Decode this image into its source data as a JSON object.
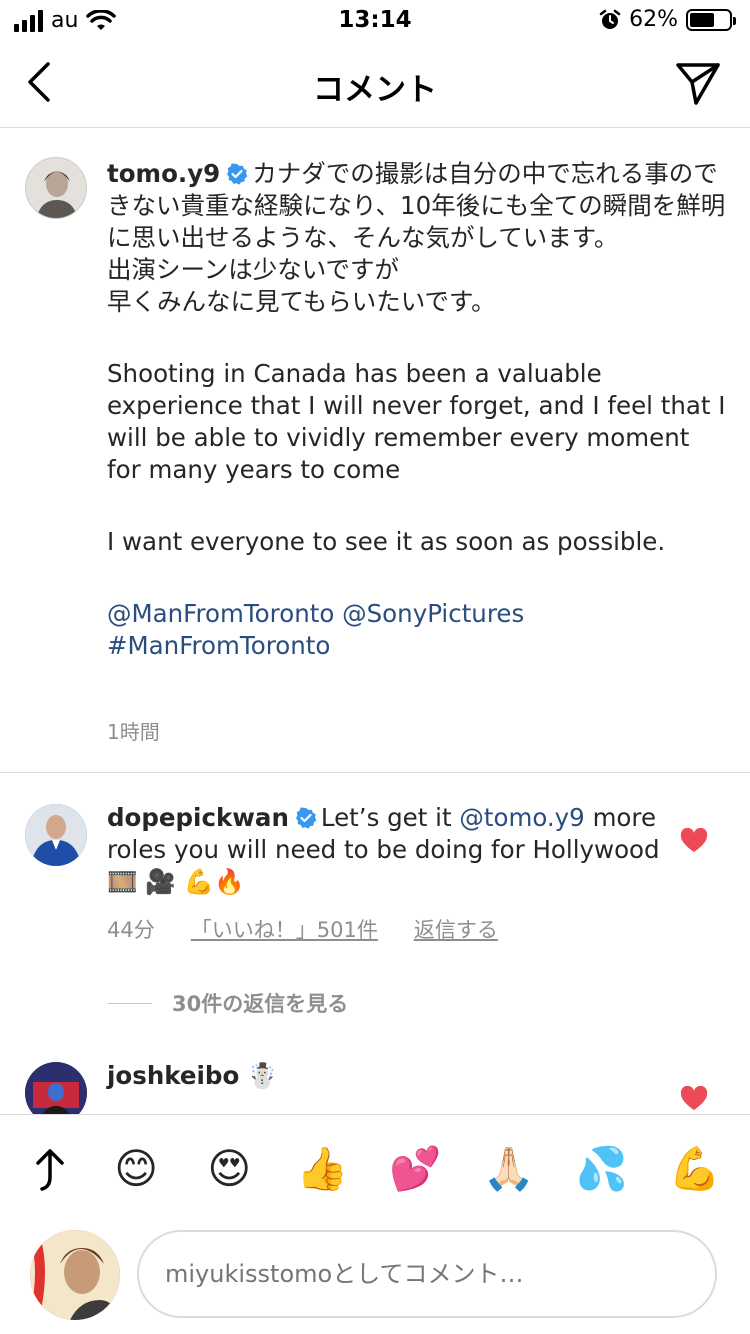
{
  "status": {
    "carrier": "au",
    "time": "13:14",
    "battery_pct": "62%",
    "battery_level": 0.62
  },
  "nav": {
    "title": "コメント",
    "back_icon": "chevron-left-icon",
    "send_icon": "paper-plane-icon"
  },
  "caption": {
    "username": "tomo.y9",
    "text_ja_1": "カナダでの撮影は自分の中で忘れる事のできない貴重な経験になり、10年後にも全ての瞬間を鮮明に思い出せるような、そんな気がしています。",
    "text_ja_2": "出演シーンは少ないですが",
    "text_ja_3": "早くみんなに見てもらいたいです。",
    "text_en_1": "Shooting in Canada has been a valuable experience that I will never forget, and I feel that I will be able to vividly remember every moment for many years to come",
    "text_en_2": "I want everyone to see it as soon as possible.",
    "mention_1": "@ManFromToronto",
    "mention_2": "@SonyPictures",
    "hashtag": "#ManFromToronto",
    "time_ago": "1時間"
  },
  "comments": [
    {
      "username": "dopepickwan",
      "text_1": "Let’s get it",
      "mention": "@tomo.y9",
      "text_2": "more roles you will need to be doing for Hollywood 🎞️ 🎥 💪🔥",
      "time_ago": "44分",
      "likes": "「いいね！」501件",
      "reply": "返信する",
      "view_replies": "30件の返信を見る",
      "liked": true
    },
    {
      "username": "joshkeibo",
      "text": "☃️",
      "liked": true
    }
  ],
  "emoji_bar": [
    "😊",
    "😍",
    "👍",
    "💕",
    "🙏🏻",
    "💦",
    "💪"
  ],
  "composer": {
    "placeholder": "miyukisstomoとしてコメント…"
  },
  "colors": {
    "verified_blue": "#3897f0",
    "heart_red": "#ed4956",
    "link_blue": "#2a4d7f",
    "meta_gray": "#8e8e8e"
  }
}
